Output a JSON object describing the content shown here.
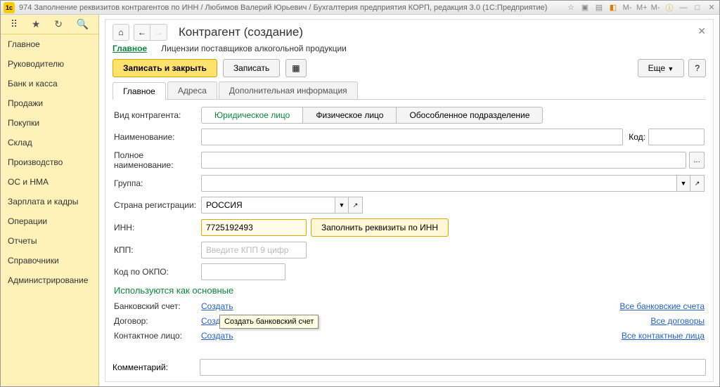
{
  "window": {
    "title": "974 Заполнение реквизитов контрагентов по ИНН / Любимов Валерий Юрьевич / Бухгалтерия предприятия КОРП, редакция 3.0   (1С:Предприятие)",
    "logo": "1c",
    "toolicons": {
      "m1": "М-",
      "m2": "М+",
      "m3": "М-"
    }
  },
  "sidebar": {
    "items": [
      "Главное",
      "Руководителю",
      "Банк и касса",
      "Продажи",
      "Покупки",
      "Склад",
      "Производство",
      "ОС и НМА",
      "Зарплата и кадры",
      "Операции",
      "Отчеты",
      "Справочники",
      "Администрирование"
    ]
  },
  "panel": {
    "title": "Контрагент (создание)",
    "subnav_active": "Главное",
    "subnav_other": "Лицензии поставщиков алкогольной продукции",
    "btn_save_close": "Записать и закрыть",
    "btn_save": "Записать",
    "btn_more": "Еще",
    "btn_help": "?"
  },
  "tabs": {
    "t1": "Главное",
    "t2": "Адреса",
    "t3": "Дополнительная информация"
  },
  "form": {
    "type_label": "Вид контрагента:",
    "type_opts": {
      "o1": "Юридическое лицо",
      "o2": "Физическое лицо",
      "o3": "Обособленное подразделение"
    },
    "name_label": "Наименование:",
    "code_label": "Код:",
    "fullname_label": "Полное наименование:",
    "group_label": "Группа:",
    "country_label": "Страна регистрации:",
    "country_value": "РОССИЯ",
    "inn_label": "ИНН:",
    "inn_value": "7725192493",
    "inn_btn": "Заполнить реквизиты по ИНН",
    "kpp_label": "КПП:",
    "kpp_placeholder": "Введите КПП 9 цифр",
    "okpo_label": "Код по ОКПО:",
    "section": "Используются как основные",
    "bank_label": "Банковский счет:",
    "create": "Создать",
    "bank_all": "Все банковские счета",
    "contract_label": "Договор:",
    "contract_create": "Созд",
    "contract_all": "Все договоры",
    "contact_label": "Контактное лицо:",
    "contact_all": "Все контактные лица",
    "comment_label": "Комментарий:",
    "tooltip": "Создать банковский счет"
  }
}
